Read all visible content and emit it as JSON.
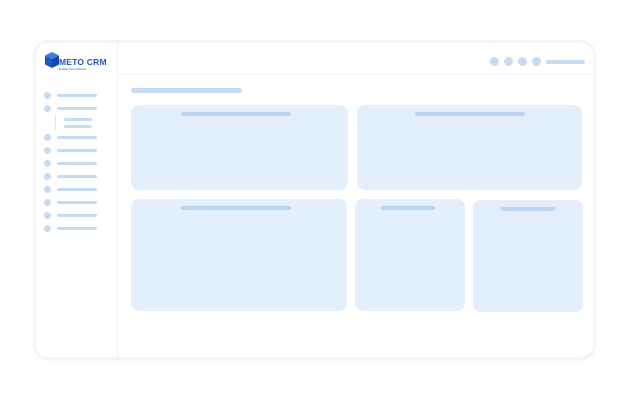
{
  "app": {
    "logo_text": "METO CRM",
    "logo_tagline": "Modular Travel Software",
    "brand_color": "#1e56c8",
    "placeholder_color": "#c5dcf3",
    "card_color": "#e3eefb"
  },
  "sidebar": {
    "items": [
      {
        "icon": "placeholder-dot-icon"
      },
      {
        "icon": "placeholder-dot-icon",
        "has_submenu": true
      },
      {
        "icon": "placeholder-dot-icon"
      },
      {
        "icon": "placeholder-dot-icon"
      },
      {
        "icon": "placeholder-dot-icon"
      },
      {
        "icon": "placeholder-dot-icon"
      },
      {
        "icon": "placeholder-dot-icon"
      },
      {
        "icon": "placeholder-dot-icon"
      },
      {
        "icon": "placeholder-dot-icon"
      },
      {
        "icon": "placeholder-dot-icon"
      },
      {
        "icon": "placeholder-dot-icon"
      }
    ],
    "submenu_items": 2
  },
  "header": {
    "action_icons": [
      "placeholder-circle-icon",
      "placeholder-circle-icon",
      "placeholder-circle-icon",
      "placeholder-circle-icon"
    ]
  }
}
